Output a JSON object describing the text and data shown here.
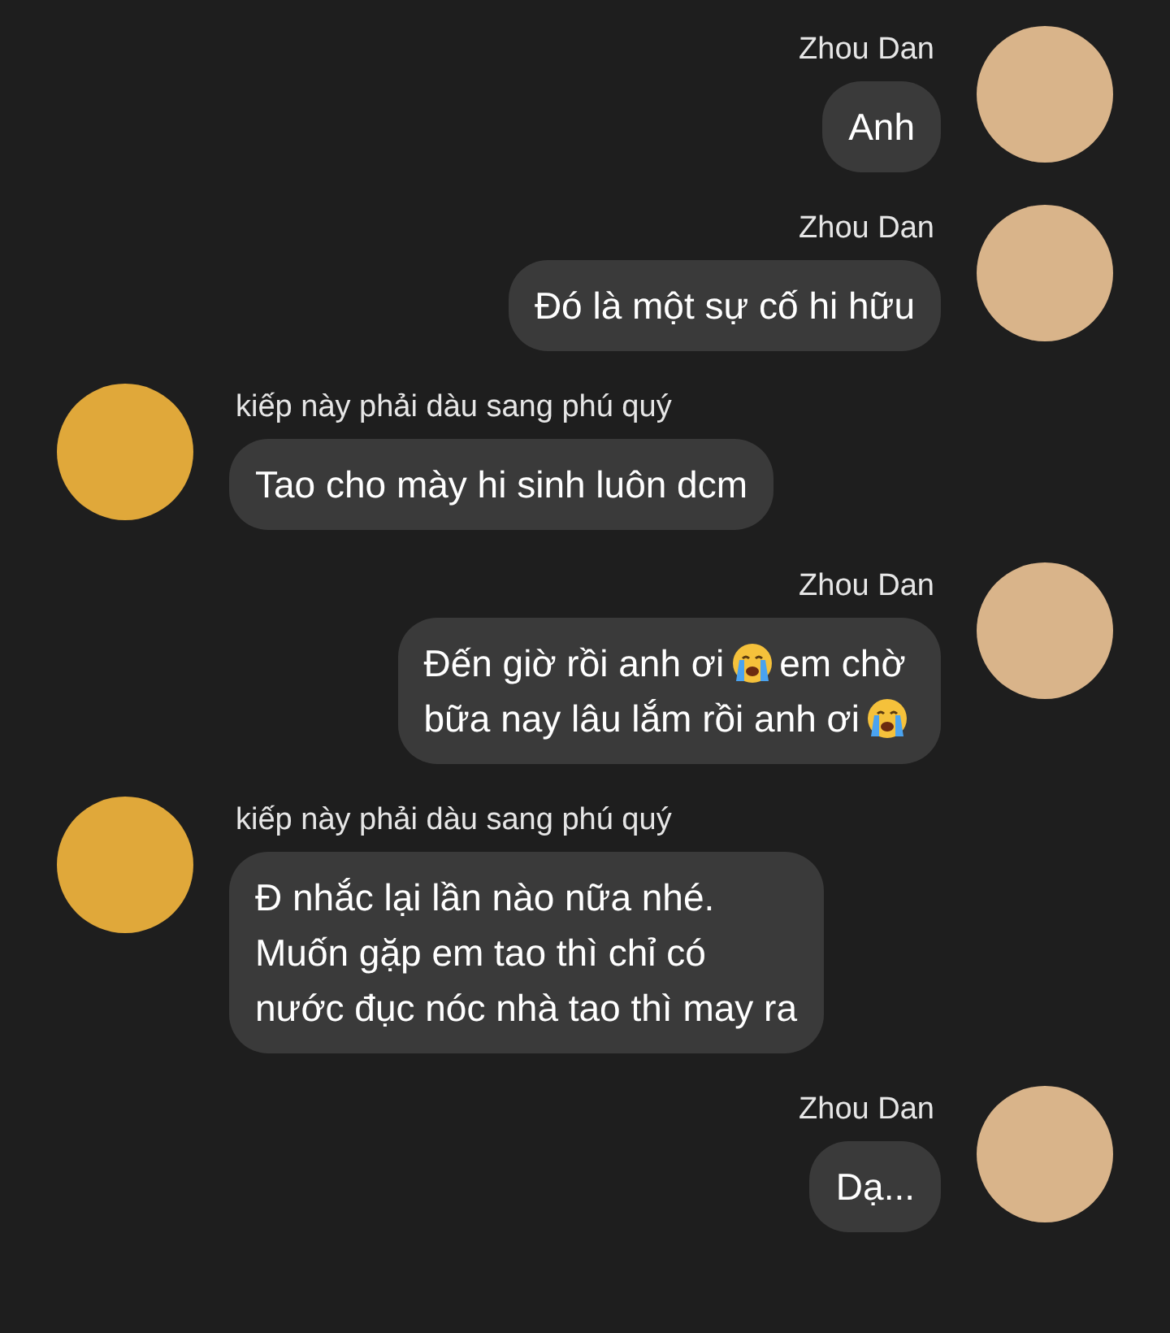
{
  "messages": [
    {
      "kind": "outgoing",
      "sender": "Zhou Dan",
      "lines": [
        [
          {
            "kind": "text",
            "text": "Anh"
          }
        ]
      ]
    },
    {
      "kind": "outgoing",
      "sender": "Zhou Dan",
      "lines": [
        [
          {
            "kind": "text",
            "text": "Đó là một sự cố hi hữu"
          }
        ]
      ]
    },
    {
      "kind": "incoming",
      "sender": "kiếp này phải dàu sang phú quý",
      "lines": [
        [
          {
            "kind": "text",
            "text": "Tao cho mày hi sinh luôn dcm"
          }
        ]
      ]
    },
    {
      "kind": "outgoing",
      "sender": "Zhou Dan",
      "lines": [
        [
          {
            "kind": "text",
            "text": "Đến giờ rồi anh ơi"
          },
          {
            "kind": "emoji"
          },
          {
            "kind": "text",
            "text": "em chờ"
          }
        ],
        [
          {
            "kind": "text",
            "text": "bữa nay lâu lắm rồi anh ơi"
          },
          {
            "kind": "emoji"
          }
        ]
      ]
    },
    {
      "kind": "incoming",
      "sender": "kiếp này phải dàu sang phú quý",
      "lines": [
        [
          {
            "kind": "text",
            "text": "Đ nhắc lại lần nào nữa nhé."
          }
        ],
        [
          {
            "kind": "text",
            "text": "Muốn gặp em tao thì chỉ có"
          }
        ],
        [
          {
            "kind": "text",
            "text": "nước đục nóc nhà tao thì may ra"
          }
        ]
      ]
    },
    {
      "kind": "outgoing",
      "sender": "Zhou Dan",
      "lines": [
        [
          {
            "kind": "text",
            "text": "Dạ..."
          }
        ]
      ]
    }
  ]
}
